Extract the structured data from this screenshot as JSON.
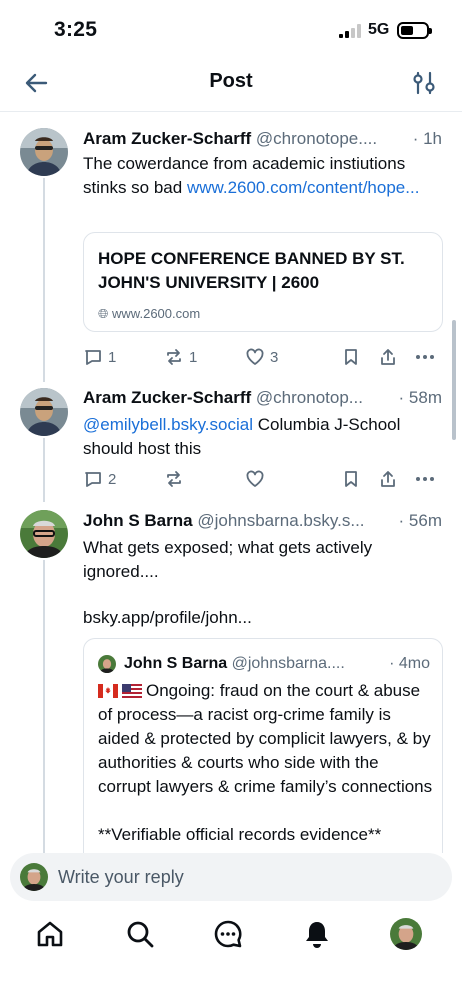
{
  "status_bar": {
    "time": "3:25",
    "network": "5G"
  },
  "header": {
    "title": "Post"
  },
  "posts": [
    {
      "name": "Aram Zucker-Scharff",
      "handle": "@chronotope....",
      "time": "· 1h",
      "text": "The cowerdance from academic instiutions stinks so bad ",
      "link": "www.2600.com/content/hope...",
      "embed": {
        "title": "HOPE CONFERENCE BANNED BY ST. JOHN'S UNIVERSITY | 2600",
        "domain": "www.2600.com"
      },
      "replies": "1",
      "reposts": "1",
      "likes": "3"
    },
    {
      "name": "Aram Zucker-Scharff",
      "handle": "@chronotop...",
      "time": "· 58m",
      "mention": "@emilybell.bsky.social",
      "text": " Columbia J-School should host this",
      "replies": "2",
      "reposts": "",
      "likes": ""
    },
    {
      "name": "John S Barna",
      "handle": "@johnsbarna.bsky.s...",
      "time": "· 56m",
      "text": "What gets exposed; what gets actively ignored....",
      "link": "bsky.app/profile/john...",
      "quote": {
        "name": "John S Barna",
        "handle": "@johnsbarna....",
        "time": "· 4mo",
        "text": "Ongoing: fraud on the court & abuse of process—a racist org-crime family is aided & protected by complicit lawyers, & by authorities & courts who side with the corrupt lawyers & crime family’s connections",
        "cut_text": "**Verifiable official records evidence**"
      }
    }
  ],
  "reply_bar": {
    "placeholder": "Write your reply"
  },
  "tabs": [
    "home-icon",
    "search-icon",
    "chat-icon",
    "notifications-icon",
    "profile-avatar"
  ],
  "colors": {
    "link": "#1a6fd8",
    "muted": "#5c6b7a",
    "border": "#dfe4ea"
  }
}
